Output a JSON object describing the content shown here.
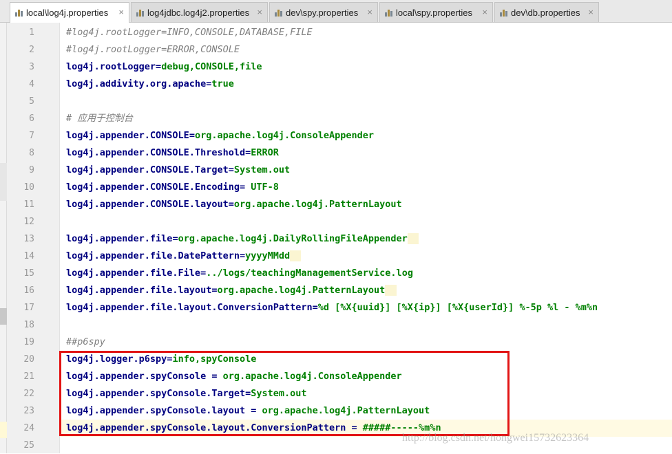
{
  "tabs": [
    {
      "label": "local\\log4j.properties",
      "active": true
    },
    {
      "label": "log4jdbc.log4j2.properties",
      "active": false
    },
    {
      "label": "dev\\spy.properties",
      "active": false
    },
    {
      "label": "local\\spy.properties",
      "active": false
    },
    {
      "label": "dev\\db.properties",
      "active": false
    }
  ],
  "close_glyph": "×",
  "lines": [
    {
      "num": "1",
      "type": "comment",
      "text": "#log4j.rootLogger=INFO,CONSOLE,DATABASE,FILE"
    },
    {
      "num": "2",
      "type": "comment",
      "text": "#log4j.rootLogger=ERROR,CONSOLE"
    },
    {
      "num": "3",
      "type": "prop",
      "key": "log4j.rootLogger",
      "sep": "=",
      "value": "debug,CONSOLE,file"
    },
    {
      "num": "4",
      "type": "prop",
      "key": "log4j.addivity.org.apache",
      "sep": "=",
      "value": "true"
    },
    {
      "num": "5",
      "type": "blank"
    },
    {
      "num": "6",
      "type": "comment",
      "text": "# 应用于控制台"
    },
    {
      "num": "7",
      "type": "prop",
      "key": "log4j.appender.CONSOLE",
      "sep": "=",
      "value": "org.apache.log4j.ConsoleAppender"
    },
    {
      "num": "8",
      "type": "prop",
      "key": "log4j.appender.CONSOLE.Threshold",
      "sep": "=",
      "value": "ERROR"
    },
    {
      "num": "9",
      "type": "prop",
      "key": "log4j.appender.CONSOLE.Target",
      "sep": "=",
      "value": "System.out"
    },
    {
      "num": "10",
      "type": "prop",
      "key": "log4j.appender.CONSOLE.Encoding",
      "sep": "= ",
      "value": "UTF-8"
    },
    {
      "num": "11",
      "type": "prop",
      "key": "log4j.appender.CONSOLE.layout",
      "sep": "=",
      "value": "org.apache.log4j.PatternLayout"
    },
    {
      "num": "12",
      "type": "blank"
    },
    {
      "num": "13",
      "type": "prop",
      "key": "log4j.appender.file",
      "sep": "=",
      "value": "org.apache.log4j.DailyRollingFileAppender",
      "trail": "  "
    },
    {
      "num": "14",
      "type": "prop",
      "key": "log4j.appender.file.DatePattern",
      "sep": "=",
      "value": "yyyyMMdd",
      "trail": "  "
    },
    {
      "num": "15",
      "type": "prop",
      "key": "log4j.appender.file.File",
      "sep": "=",
      "value": "../logs/teachingManagementService.log"
    },
    {
      "num": "16",
      "type": "prop",
      "key": "log4j.appender.file.layout",
      "sep": "=",
      "value": "org.apache.log4j.PatternLayout",
      "trail": "  "
    },
    {
      "num": "17",
      "type": "prop",
      "key": "log4j.appender.file.layout.ConversionPattern",
      "sep": "=",
      "value": "%d [%X{uuid}] [%X{ip}] [%X{userId}] %-5p %l - %m%n"
    },
    {
      "num": "18",
      "type": "blank"
    },
    {
      "num": "19",
      "type": "comment",
      "text": "##p6spy"
    },
    {
      "num": "20",
      "type": "prop",
      "key": "log4j.logger.p6spy",
      "sep": "=",
      "value": "info,spyConsole"
    },
    {
      "num": "21",
      "type": "prop",
      "key": "log4j.appender.spyConsole",
      "sep": " = ",
      "value": "org.apache.log4j.ConsoleAppender"
    },
    {
      "num": "22",
      "type": "prop",
      "key": "log4j.appender.spyConsole.Target",
      "sep": "=",
      "value": "System.out"
    },
    {
      "num": "23",
      "type": "prop",
      "key": "log4j.appender.spyConsole.layout",
      "sep": " = ",
      "value": "org.apache.log4j.PatternLayout"
    },
    {
      "num": "24",
      "type": "prop",
      "key": "log4j.appender.spyConsole.layout.ConversionPattern",
      "sep": " = ",
      "value": "#####-----%m%n",
      "current": true
    },
    {
      "num": "25",
      "type": "blank"
    }
  ],
  "watermark": "http://blog.csdn.net/hongwei15732623364",
  "colors": {
    "key": "#000080",
    "value": "#008000",
    "comment": "#808080",
    "highlight_box": "#e21414"
  }
}
